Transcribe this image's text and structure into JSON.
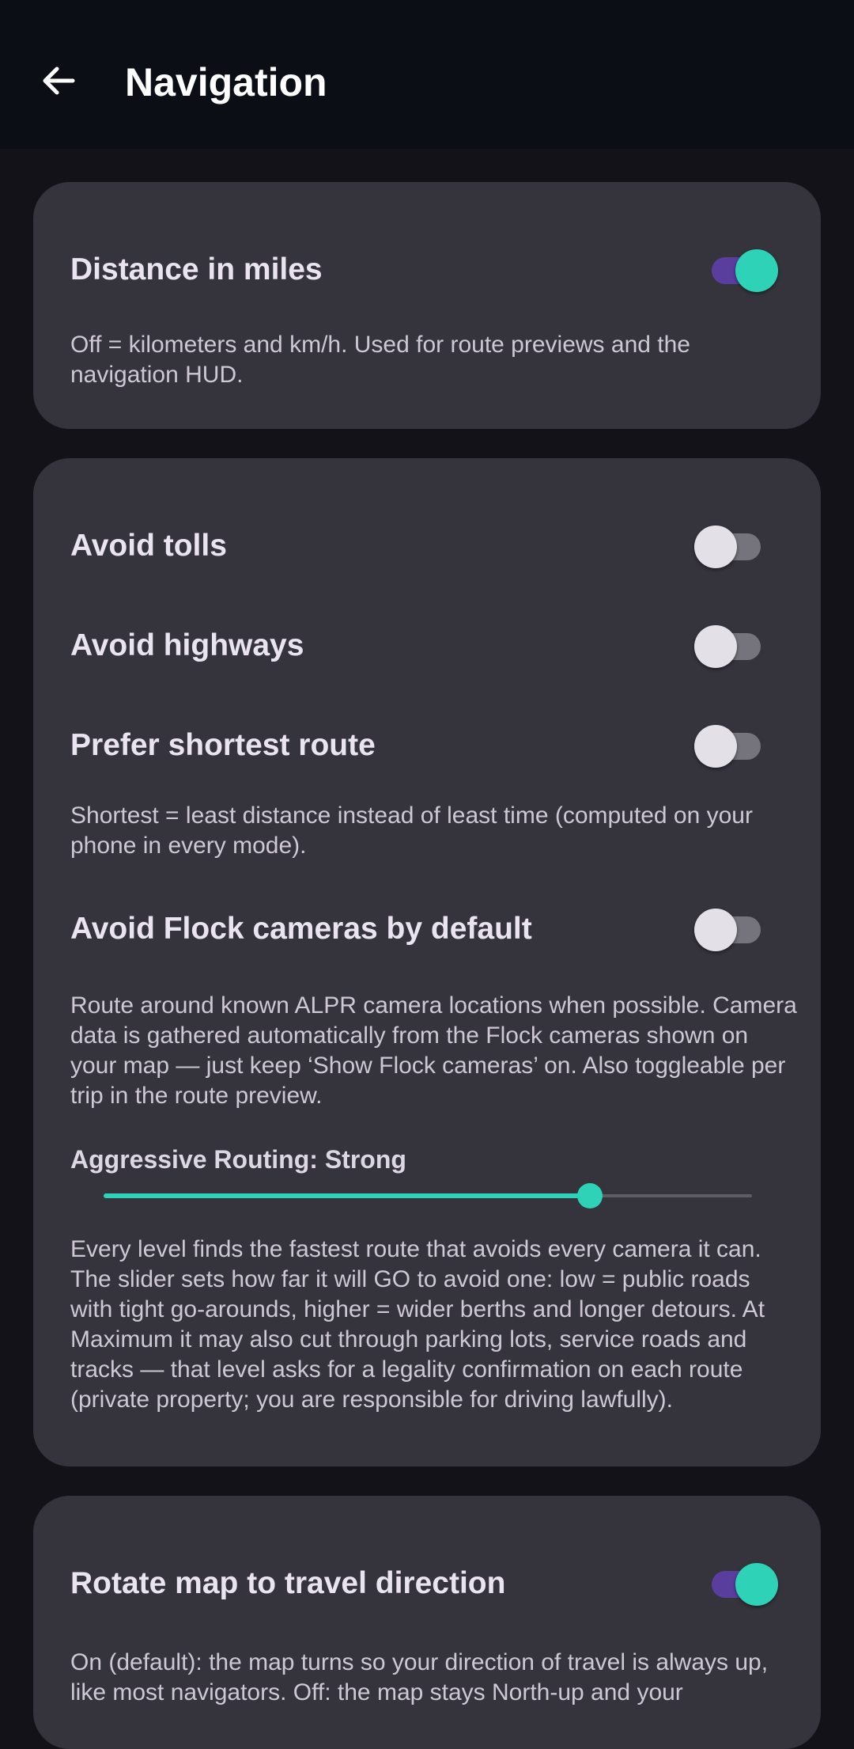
{
  "header": {
    "title": "Navigation",
    "back_icon": "arrow-left-icon"
  },
  "units_card": {
    "miles": {
      "label": "Distance in miles",
      "enabled": true,
      "description": "Off = kilometers and km/h. Used for route previews and the navigation HUD."
    }
  },
  "routing_card": {
    "avoid_tolls": {
      "label": "Avoid tolls",
      "enabled": false
    },
    "avoid_highways": {
      "label": "Avoid highways",
      "enabled": false
    },
    "prefer_shortest": {
      "label": "Prefer shortest route",
      "enabled": false,
      "description": "Shortest = least distance instead of least time (computed on your phone in every mode)."
    },
    "avoid_flock": {
      "label": "Avoid Flock cameras by default",
      "enabled": false,
      "description": "Route around known ALPR camera locations when possible. Camera data is gathered automatically from the Flock cameras shown on your map — just keep ‘Show Flock cameras’ on. Also toggleable per trip in the route preview."
    },
    "aggressive_routing": {
      "label": "Aggressive Routing: Strong",
      "value_fraction": 0.75,
      "description": "Every level finds the fastest route that avoids every camera it can. The slider sets how far it will GO to avoid one: low = public roads with tight go-arounds, higher = wider berths and longer detours. At Maximum it may also cut through parking lots, service roads and tracks — that level asks for a legality confirmation on each route (private property; you are responsible for driving lawfully)."
    }
  },
  "map_card": {
    "rotate_map": {
      "label": "Rotate map to travel direction",
      "enabled": true,
      "description": "On (default): the map turns so your direction of travel is always up, like most navigators. Off: the map stays North-up and your"
    }
  },
  "colors": {
    "accent": "#2ed3b7",
    "switch_track_on": "#5a3e9e",
    "card_background": "#35343d",
    "page_background": "#131218",
    "top_bar": "#0b0f15"
  }
}
